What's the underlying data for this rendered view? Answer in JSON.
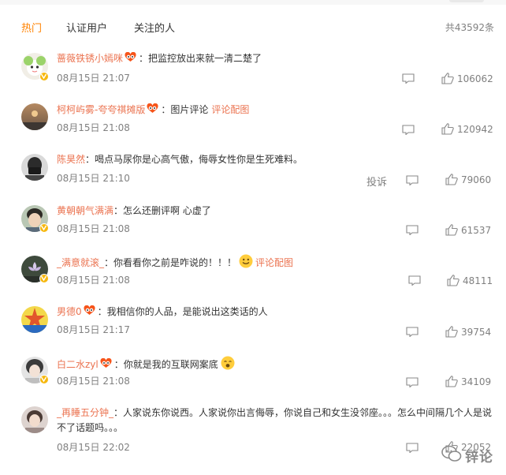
{
  "tabs": [
    {
      "label": "热门",
      "active": true
    },
    {
      "label": "认证用户",
      "active": false
    },
    {
      "label": "关注的人",
      "active": false
    }
  ],
  "total": "共43592条",
  "report_label": "投诉",
  "pic_comment_label": "评论配图",
  "comments": [
    {
      "user": "蔷薇铁锈小嫣咪",
      "text": "：把监控放出来就一清二楚了",
      "time": "08月15日 21:07",
      "likes": "106062"
    },
    {
      "user": "柯柯屿雾-夸夸祺摊版",
      "text": "：图片评论",
      "time": "08月15日 21:08",
      "likes": "120942"
    },
    {
      "user": "陈昊然",
      "text": "：喝点马尿你是心高气傲，侮辱女性你是生死难料。",
      "time": "08月15日 21:10",
      "likes": "79060"
    },
    {
      "user": "黄朝朝气满满",
      "text": "：怎么还删评啊 心虚了",
      "time": "08月15日 21:08",
      "likes": "61537"
    },
    {
      "user": "_满意就滚_",
      "text": "：你看看你之前是咋说的！！！",
      "time": "08月15日 21:08",
      "likes": "48111"
    },
    {
      "user": "男德0",
      "text": "：我相信你的人品，是能说出这类话的人",
      "time": "08月15日 21:17",
      "likes": "39754"
    },
    {
      "user": "白二水zyl",
      "text": "：你就是我的互联网案底",
      "time": "08月15日 21:08",
      "likes": "34109"
    },
    {
      "user": "_再睡五分钟_",
      "text": "：人家说东你说西。人家说你出言侮辱，你说自己和女生没邻座。。。怎么中间隔几个人是说不了话题吗。。。",
      "time": "08月15日 22:02",
      "likes": "22052"
    }
  ],
  "watermark": "锌论",
  "colors": {
    "accent": "#ff8200",
    "username": "#eb7350",
    "muted": "#808080",
    "badge": "#f6b80f"
  }
}
